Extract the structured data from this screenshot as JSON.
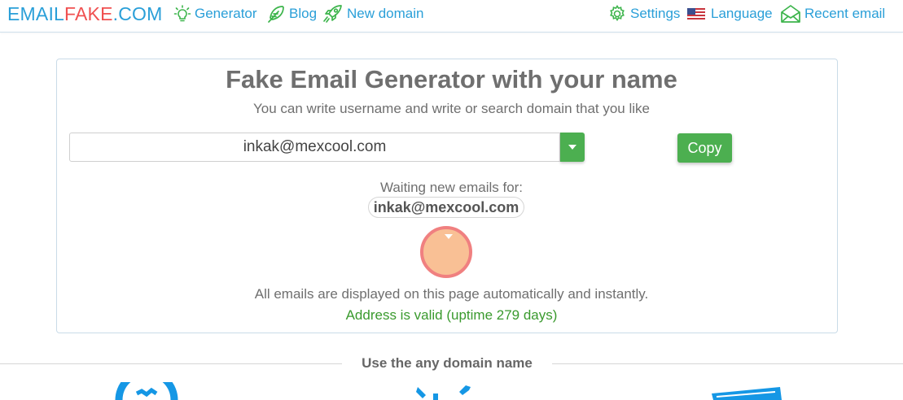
{
  "brand": {
    "part1": "EMAIL",
    "part2": "FAKE",
    "part3": ".COM"
  },
  "nav": {
    "generator": "Generator",
    "blog": "Blog",
    "new_domain": "New domain",
    "settings": "Settings",
    "language": "Language",
    "recent_email": "Recent email"
  },
  "main": {
    "title": "Fake Email Generator with your name",
    "subtitle": "You can write username and write or search domain that you like",
    "email_value": "inkak@mexcool.com",
    "copy_label": "Copy",
    "waiting_label": "Waiting new emails for:",
    "waiting_email": "inkak@mexcool.com",
    "info_text": "All emails are displayed on this page automatically and instantly.",
    "valid_text": "Address is valid (uptime 279 days)"
  },
  "section": {
    "title": "Use the any domain name"
  },
  "icons": {
    "generator": "lightbulb-icon",
    "blog": "feather-icon",
    "new_domain": "rocket-icon",
    "settings": "gear-icon",
    "language": "us-flag-icon",
    "recent_email": "envelope-icon",
    "dropdown": "caret-down-icon",
    "loader": "loading-indicator"
  },
  "colors": {
    "brand_blue": "#2a9fd8",
    "brand_red": "#f05050",
    "nav_icon_green": "#3cb44b",
    "button_green": "#4caf50",
    "valid_green": "#3a9a2e",
    "loader_fill": "#f9c095",
    "loader_ring": "#f08080",
    "feature_blue": "#1597e5"
  }
}
